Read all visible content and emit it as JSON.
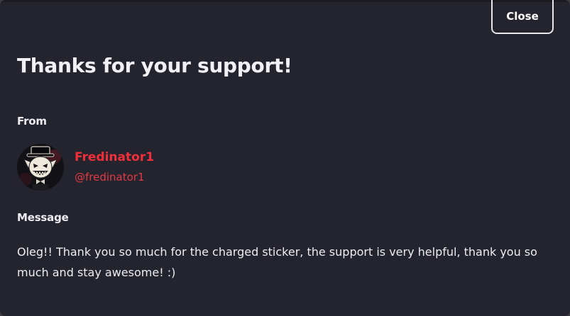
{
  "dialog": {
    "close_label": "Close",
    "title": "Thanks for your support!",
    "from_label": "From",
    "message_label": "Message"
  },
  "sender": {
    "display_name": "Fredinator1",
    "handle": "@fredinator1",
    "avatar": "cartoon-character-avatar",
    "name_color": "#f12f3a"
  },
  "message": {
    "text": "Oleg!! Thank you so much for the charged sticker, the support is very helpful, thank you so much and stay awesome! :)"
  },
  "colors": {
    "background": "#24242e",
    "text": "#ececf1",
    "accent": "#f12f3a"
  }
}
